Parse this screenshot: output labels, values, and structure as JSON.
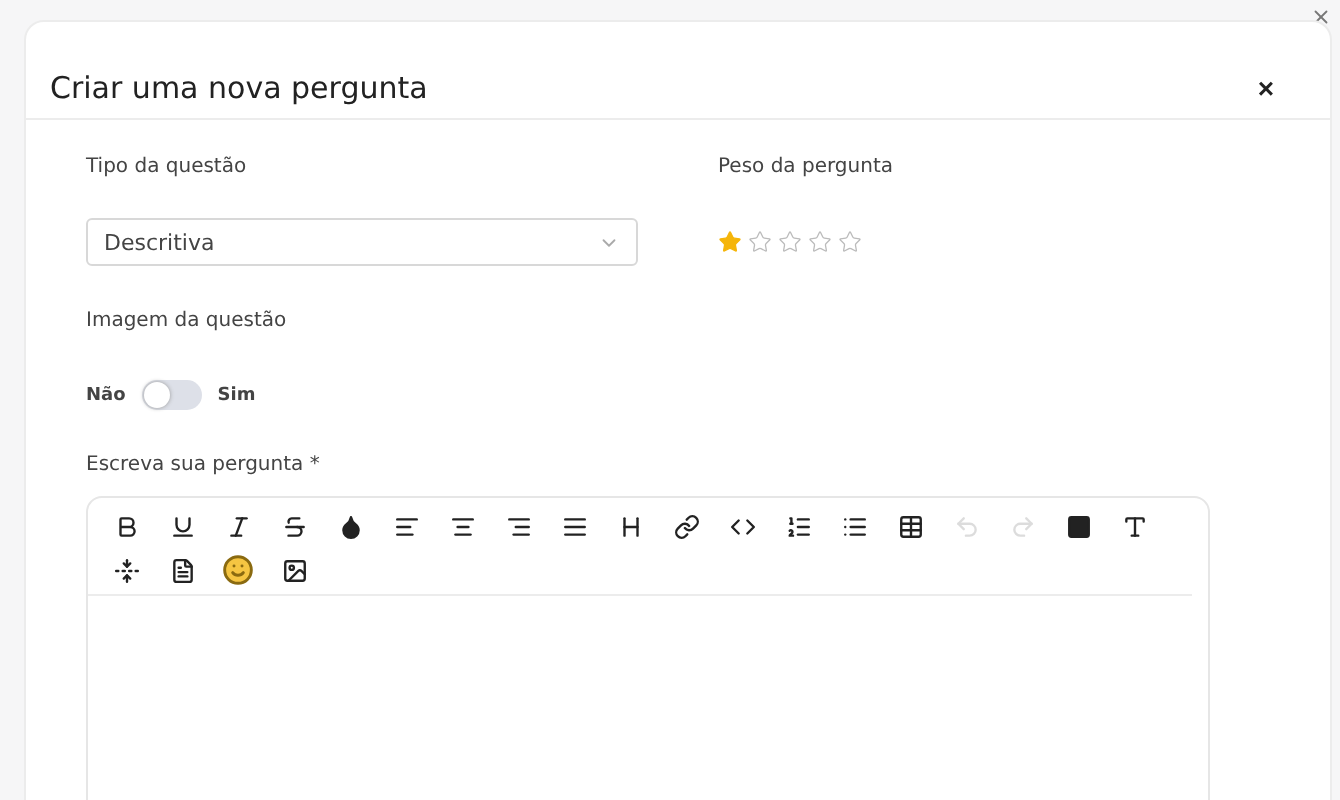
{
  "dialog": {
    "title": "Criar uma nova pergunta",
    "close": "×"
  },
  "question_type": {
    "label": "Tipo da questão",
    "value": "Descritiva"
  },
  "weight": {
    "label": "Peso da pergunta",
    "stars": 1
  },
  "image": {
    "label": "Imagem da questão",
    "off_label": "Não",
    "on_label": "Sim",
    "on": false
  },
  "question": {
    "label": "Escreva sua pergunta *"
  },
  "toolbar": [
    {
      "kind": "bold",
      "disabled": false
    },
    {
      "kind": "underline",
      "disabled": false
    },
    {
      "kind": "italic",
      "disabled": false
    },
    {
      "kind": "strike",
      "disabled": false
    },
    {
      "kind": "drop",
      "disabled": false
    },
    {
      "kind": "left",
      "disabled": false
    },
    {
      "kind": "center",
      "disabled": false
    },
    {
      "kind": "right",
      "disabled": false
    },
    {
      "kind": "justify",
      "disabled": false
    },
    {
      "kind": "heading",
      "disabled": false
    },
    {
      "kind": "link",
      "disabled": false
    },
    {
      "kind": "code",
      "disabled": false
    },
    {
      "kind": "ol",
      "disabled": false
    },
    {
      "kind": "ul",
      "disabled": false
    },
    {
      "kind": "table",
      "disabled": false
    },
    {
      "kind": "undo",
      "disabled": true
    },
    {
      "kind": "redo",
      "disabled": true
    },
    {
      "kind": "color",
      "disabled": false
    },
    {
      "kind": "font",
      "disabled": false
    },
    {
      "kind": "spacing",
      "disabled": false
    },
    {
      "kind": "file",
      "disabled": false
    },
    {
      "kind": "emoji",
      "disabled": false
    },
    {
      "kind": "image",
      "disabled": false
    }
  ]
}
